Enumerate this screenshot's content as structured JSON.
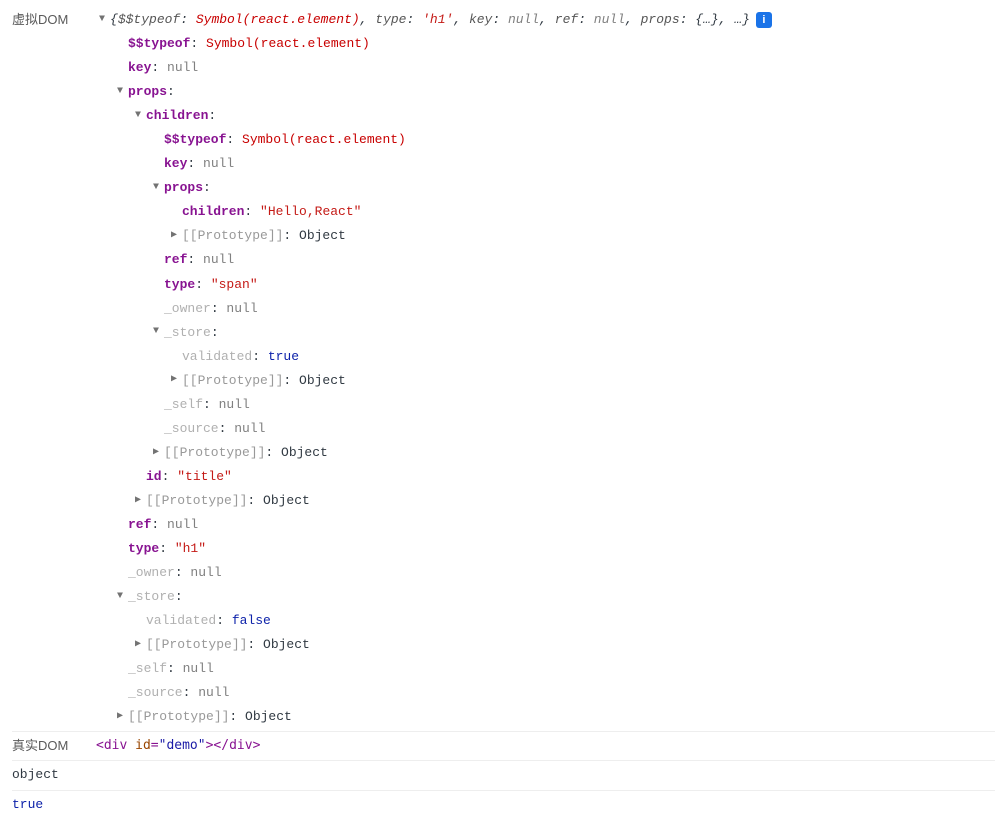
{
  "labels": {
    "virtual_dom": "虚拟DOM",
    "real_dom": "真实DOM"
  },
  "summary": {
    "k_typeof": "$$typeof",
    "v_typeof": "Symbol(react.element)",
    "k_type": "type",
    "v_type": "'h1'",
    "k_key": "key",
    "v_key": "null",
    "k_ref": "ref",
    "v_ref": "null",
    "k_props": "props",
    "v_props": "{…}",
    "ellipsis": "…"
  },
  "keys": {
    "typeof": "$$typeof",
    "key": "key",
    "props": "props",
    "children": "children",
    "prototype": "[[Prototype]]",
    "ref": "ref",
    "type": "type",
    "owner": "_owner",
    "store": "_store",
    "validated": "validated",
    "self": "_self",
    "source": "_source",
    "id": "id"
  },
  "vals": {
    "react_element": "Symbol(react.element)",
    "null": "null",
    "object": "Object",
    "hello_react": "\"Hello,React\"",
    "span": "\"span\"",
    "h1": "\"h1\"",
    "title": "\"title\"",
    "true": "true",
    "false": "false"
  },
  "real_dom": {
    "open1": "<",
    "tag": "div",
    "attr": "id",
    "eq": "=",
    "val": "\"demo\"",
    "close1": ">",
    "open2": "</",
    "close2": ">"
  },
  "bottom": {
    "object": "object",
    "true": "true"
  },
  "info": "i"
}
